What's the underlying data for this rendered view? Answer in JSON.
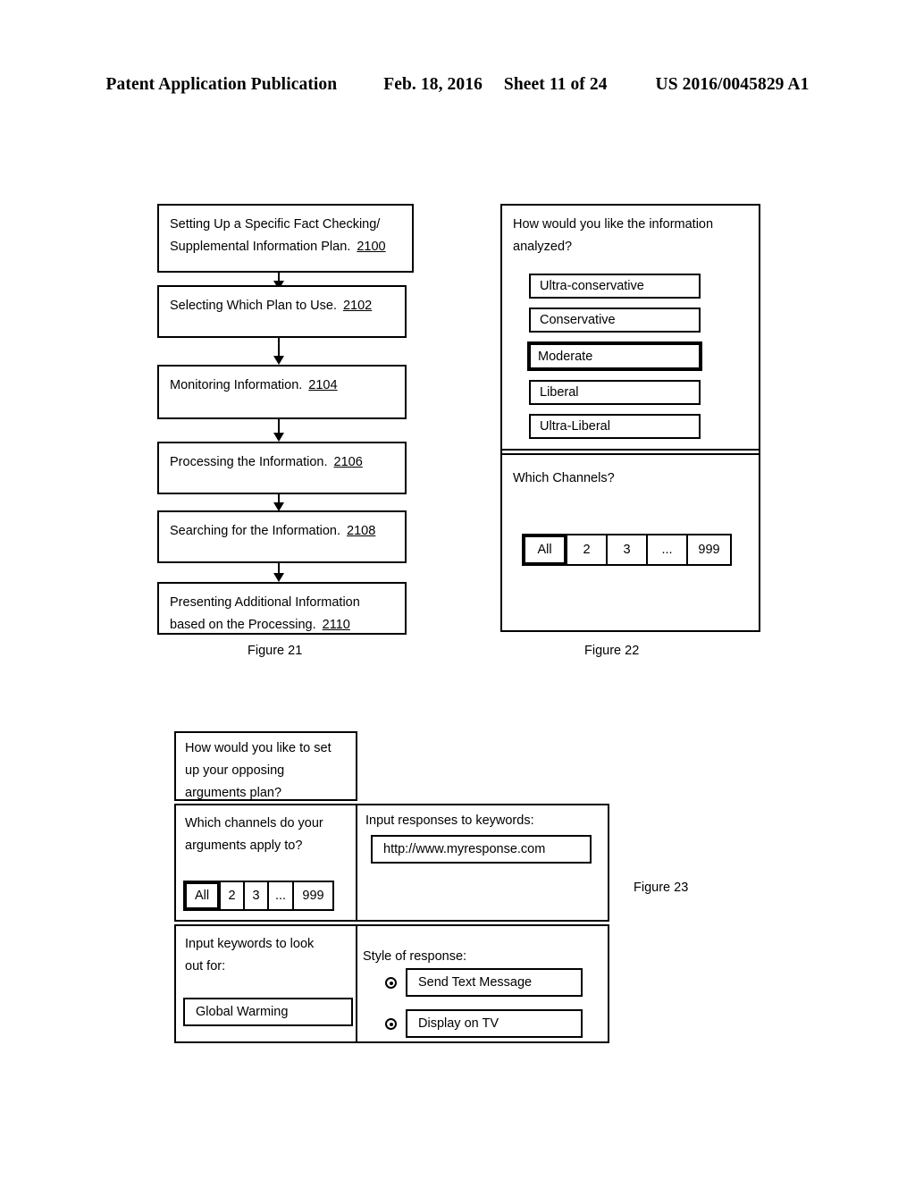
{
  "header": {
    "publication": "Patent Application Publication",
    "date": "Feb. 18, 2016",
    "sheet": "Sheet 11 of 24",
    "number": "US 2016/0045829 A1"
  },
  "figure21": {
    "caption": "Figure 21",
    "steps": [
      {
        "line1": "Setting Up a Specific Fact Checking/",
        "line2": "Supplemental Information Plan.",
        "ref": "2100"
      },
      {
        "line1": "Selecting Which Plan to Use.",
        "line2": "",
        "ref": "2102"
      },
      {
        "line1": "Monitoring Information.",
        "line2": "",
        "ref": "2104"
      },
      {
        "line1": "Processing the Information.",
        "line2": "",
        "ref": "2106"
      },
      {
        "line1": "Searching for the Information.",
        "line2": "",
        "ref": "2108"
      },
      {
        "line1": "Presenting Additional Information",
        "line2": "based on the Processing.",
        "ref": "2110"
      }
    ]
  },
  "figure22": {
    "caption": "Figure 22",
    "question_line1": "How would you like the information",
    "question_line2": "analyzed?",
    "options": [
      {
        "label": "Ultra-conservative",
        "selected": false
      },
      {
        "label": "Conservative",
        "selected": false
      },
      {
        "label": "Moderate",
        "selected": true
      },
      {
        "label": "Liberal",
        "selected": false
      },
      {
        "label": "Ultra-Liberal",
        "selected": false
      }
    ],
    "channels_question": "Which Channels?",
    "channels": [
      {
        "label": "All",
        "selected": true
      },
      {
        "label": "2",
        "selected": false
      },
      {
        "label": "3",
        "selected": false
      },
      {
        "label": "...",
        "selected": false
      },
      {
        "label": "999",
        "selected": false
      }
    ]
  },
  "figure23": {
    "caption": "Figure 23",
    "title_line1": "How would you like to set",
    "title_line2": "up your opposing",
    "title_line3": "arguments plan?",
    "channels_question_line1": "Which channels do your",
    "channels_question_line2": "arguments apply to?",
    "channels": [
      {
        "label": "All",
        "selected": true
      },
      {
        "label": "2",
        "selected": false
      },
      {
        "label": "3",
        "selected": false
      },
      {
        "label": "...",
        "selected": false
      },
      {
        "label": "999",
        "selected": false
      }
    ],
    "responses_label": "Input responses to keywords:",
    "responses_value": "http://www.myresponse.com",
    "keywords_label_line1": "Input keywords to look",
    "keywords_label_line2": "out for:",
    "keywords_value": "Global Warming",
    "style_label": "Style of response:",
    "style_options": [
      {
        "label": "Send Text Message"
      },
      {
        "label": "Display on TV"
      }
    ]
  }
}
